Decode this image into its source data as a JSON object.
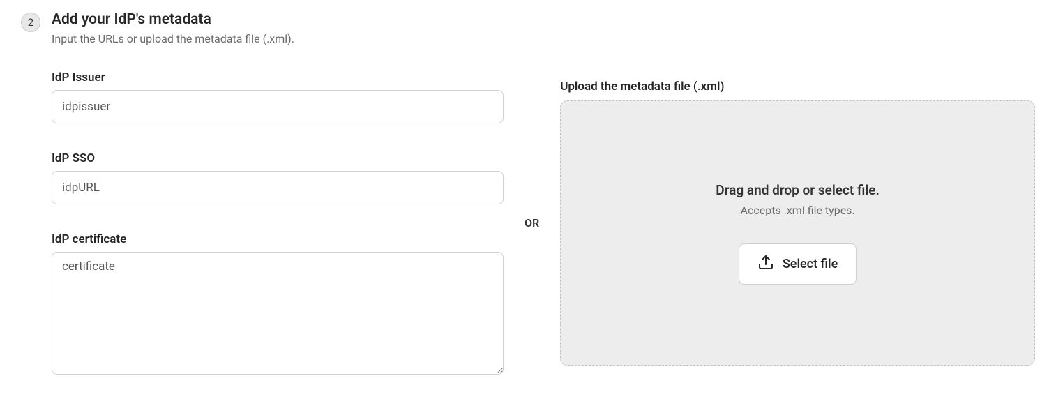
{
  "step": {
    "number": "2",
    "title": "Add your IdP's metadata",
    "description": "Input the URLs or upload the metadata file (.xml)."
  },
  "fields": {
    "issuer": {
      "label": "IdP Issuer",
      "value": "idpissuer"
    },
    "sso": {
      "label": "IdP SSO",
      "value": "idpURL"
    },
    "certificate": {
      "label": "IdP certificate",
      "value": "certificate"
    }
  },
  "separator": "OR",
  "upload": {
    "label": "Upload the metadata file (.xml)",
    "dropTitle": "Drag and drop or select file.",
    "dropSub": "Accepts .xml file types.",
    "buttonLabel": "Select file"
  }
}
